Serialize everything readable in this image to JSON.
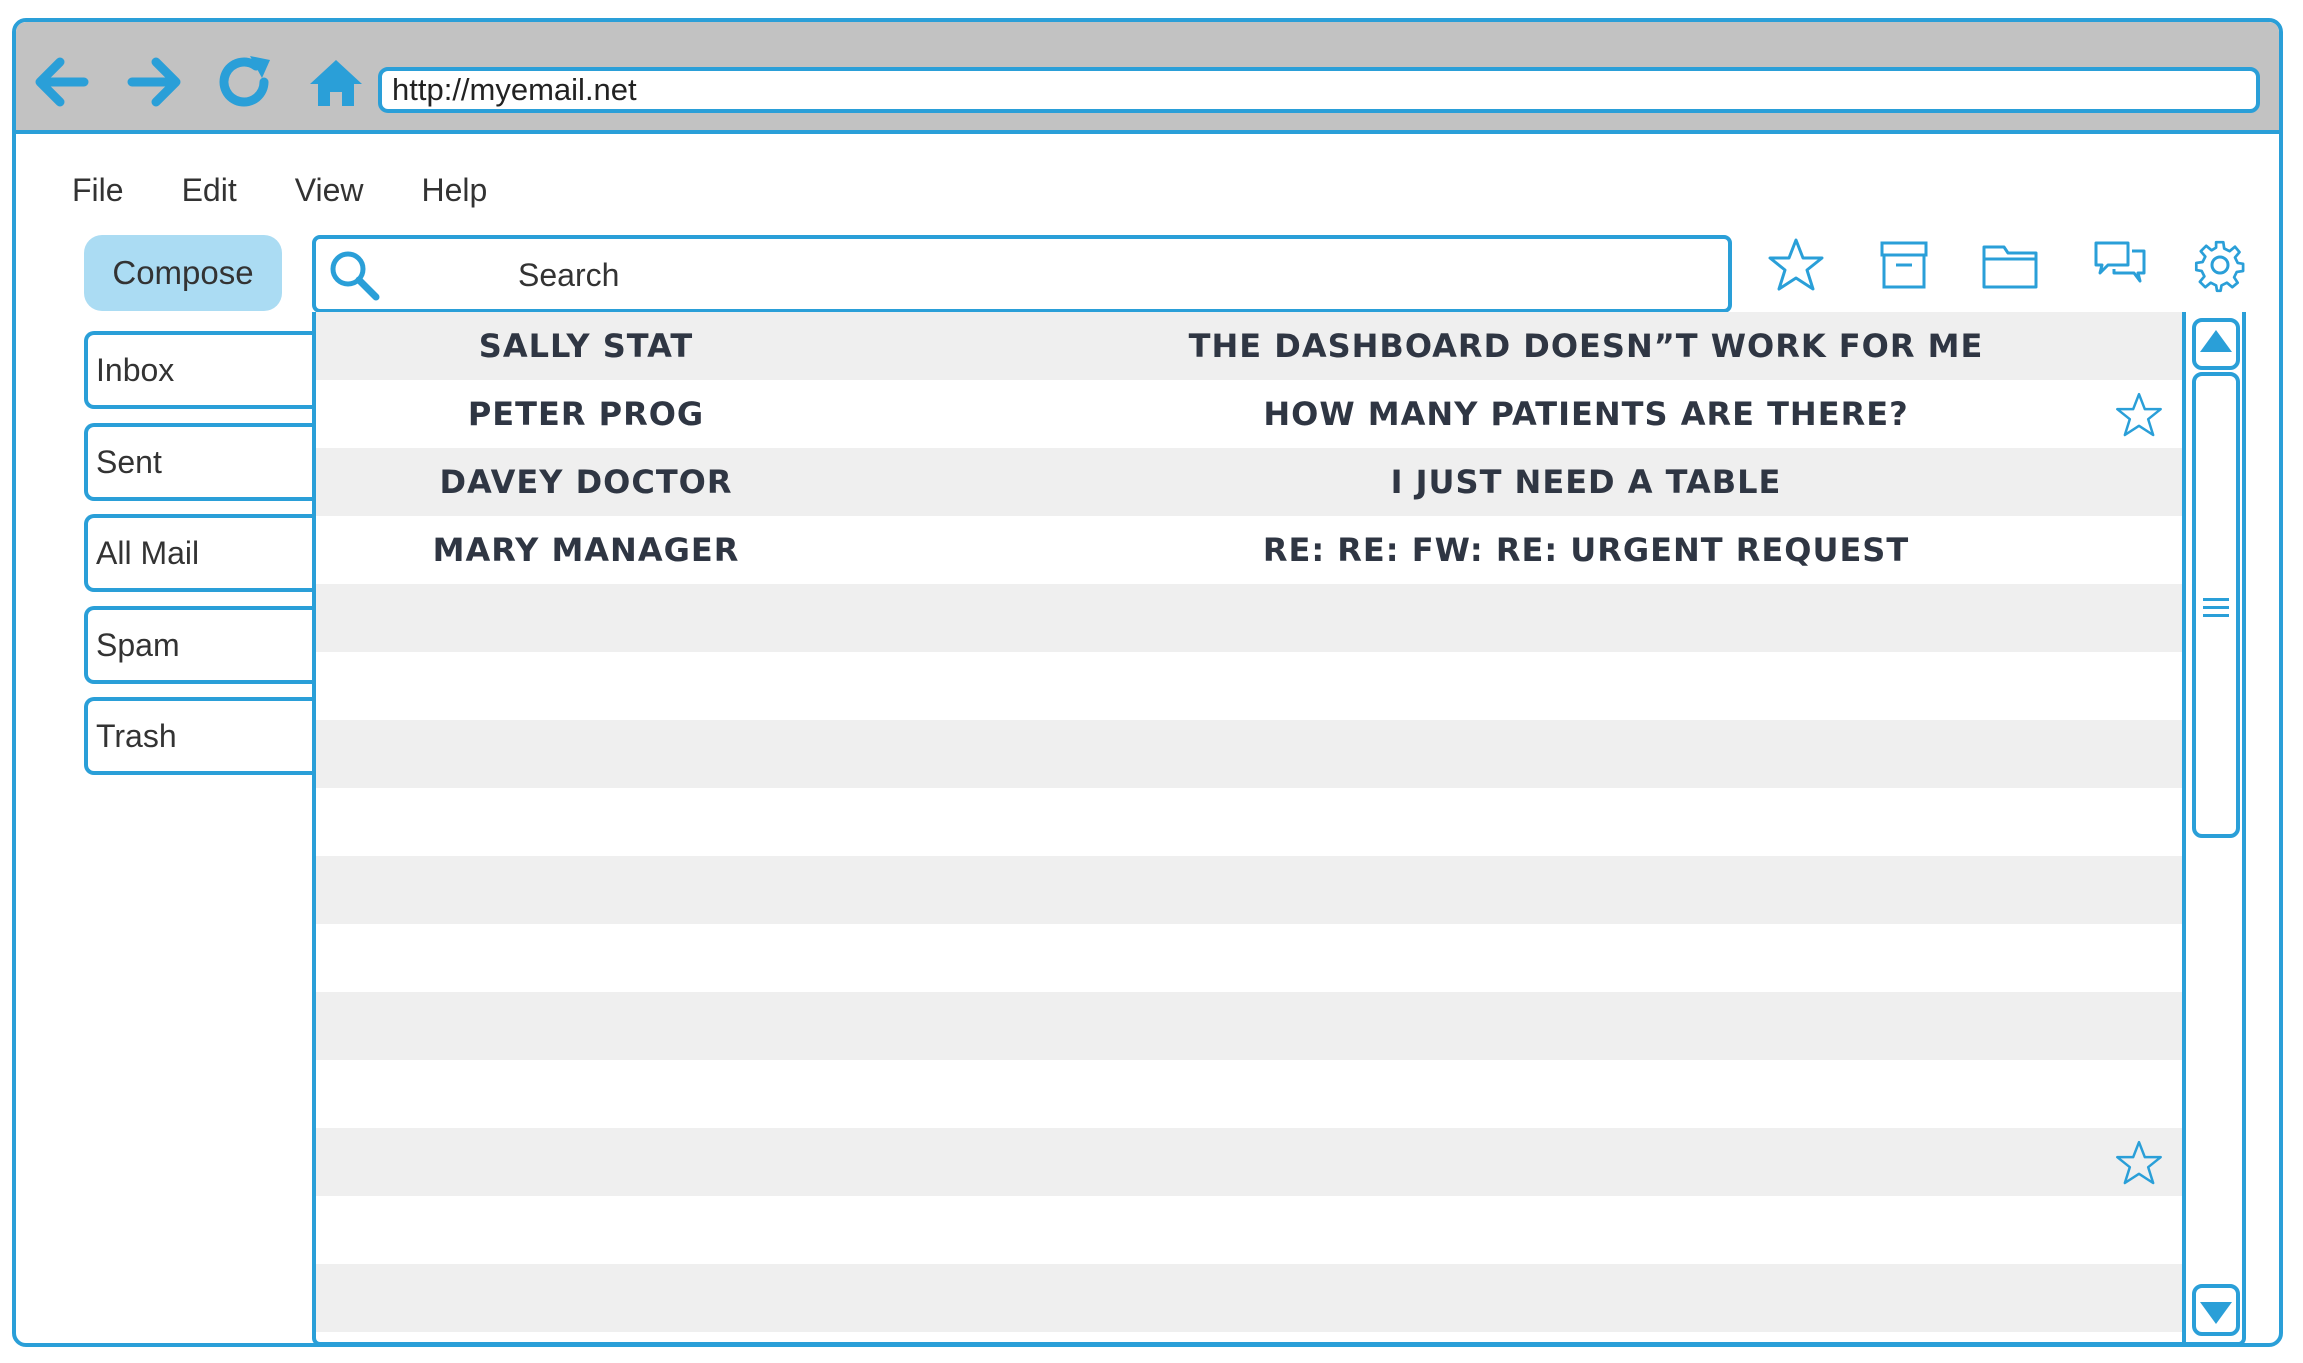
{
  "browser": {
    "url": "http://myemail.net",
    "icons": [
      "back-arrow-icon",
      "forward-arrow-icon",
      "refresh-icon",
      "home-icon"
    ]
  },
  "menu": [
    "File",
    "Edit",
    "View",
    "Help"
  ],
  "compose_label": "Compose",
  "search": {
    "placeholder": "Search"
  },
  "toolbar_icons": [
    "star-icon",
    "archive-icon",
    "folder-icon",
    "chat-icon",
    "settings-gear-icon"
  ],
  "folders": [
    "Inbox",
    "Sent",
    "All Mail",
    "Spam",
    "Trash"
  ],
  "emails": [
    {
      "sender": "SALLY STAT",
      "subject": "THE DASHBOARD DOESN”T WORK FOR ME",
      "starred": false
    },
    {
      "sender": "PETER PROG",
      "subject": "HOW MANY PATIENTS ARE THERE?",
      "starred": true
    },
    {
      "sender": "DAVEY DOCTOR",
      "subject": "I JUST NEED A TABLE",
      "starred": false
    },
    {
      "sender": "MARY MANAGER",
      "subject": "RE: RE: FW: RE: URGENT REQUEST",
      "starred": false
    },
    {
      "sender": "",
      "subject": "",
      "starred": false
    },
    {
      "sender": "",
      "subject": "",
      "starred": false
    },
    {
      "sender": "",
      "subject": "",
      "starred": false
    },
    {
      "sender": "",
      "subject": "",
      "starred": false
    },
    {
      "sender": "",
      "subject": "",
      "starred": false
    },
    {
      "sender": "",
      "subject": "",
      "starred": false
    },
    {
      "sender": "",
      "subject": "",
      "starred": false
    },
    {
      "sender": "",
      "subject": "",
      "starred": false
    },
    {
      "sender": "",
      "subject": "",
      "starred": true
    },
    {
      "sender": "",
      "subject": "",
      "starred": false
    },
    {
      "sender": "",
      "subject": "",
      "starred": false
    }
  ],
  "colors": {
    "accent": "#2a9fd8",
    "titlebar": "#c2c2c2",
    "compose_bg": "#abdcf3",
    "row_shade": "#efefef",
    "text": "#2f3643"
  }
}
